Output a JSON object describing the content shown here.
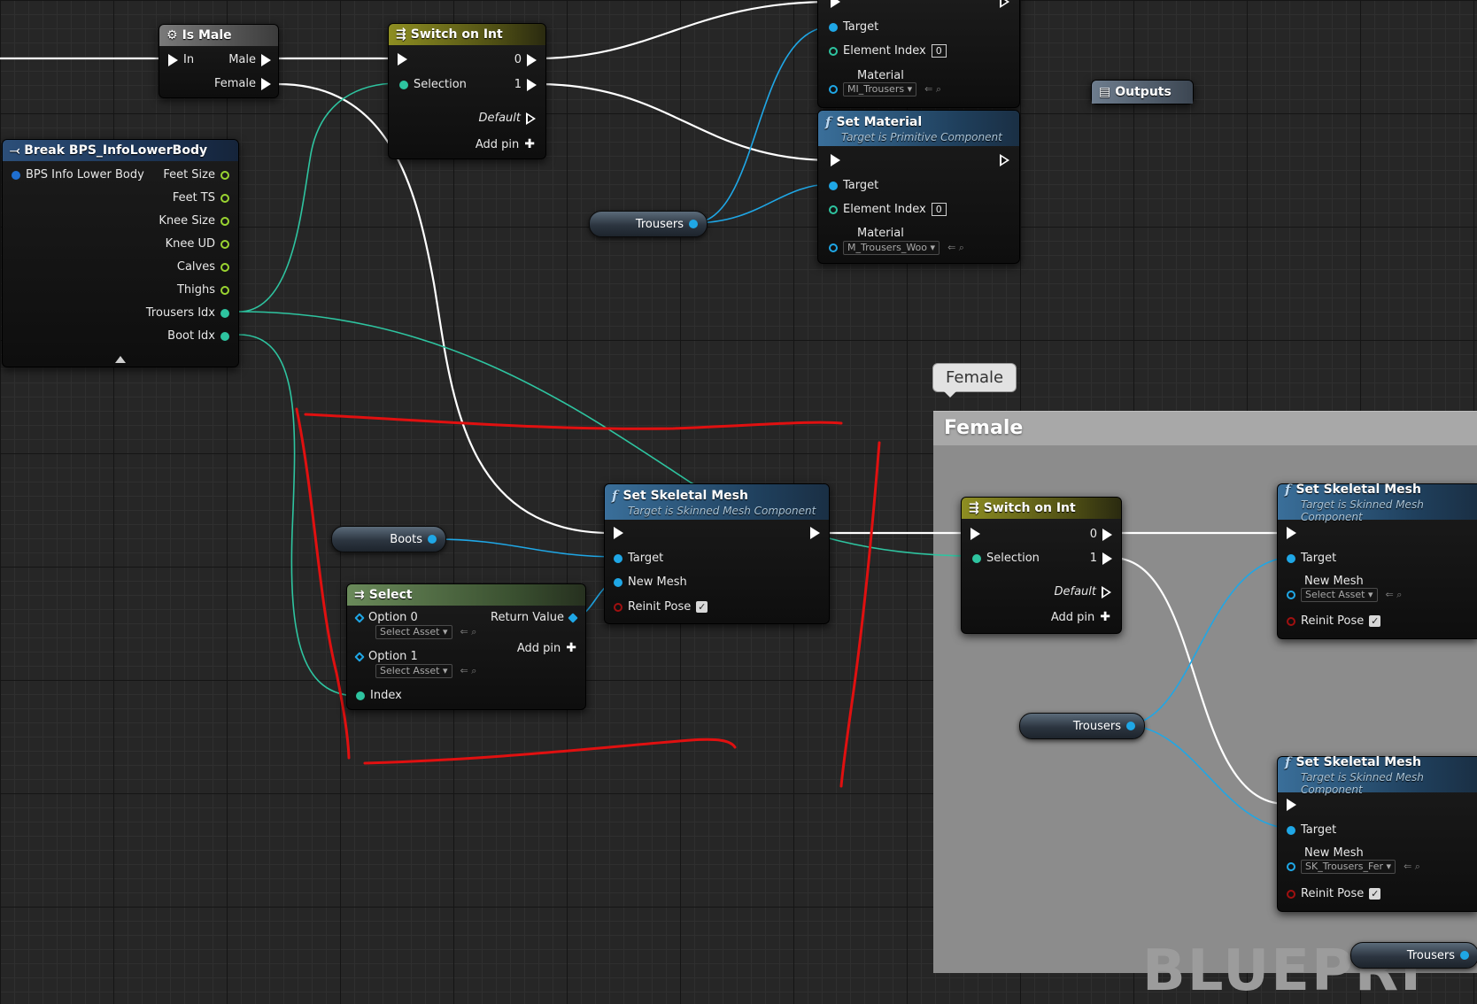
{
  "colors": {
    "exec_wire": "#ffffff",
    "int_wire": "#2ec4a0",
    "object_wire": "#1fa7e6",
    "annotation": "#e01010",
    "comment_fill": "#8c8c8c"
  },
  "nodes": {
    "is_male": {
      "title": "Is Male",
      "in": "In",
      "male": "Male",
      "female": "Female"
    },
    "switch_top": {
      "title": "Switch on Int",
      "selection": "Selection",
      "out0": "0",
      "out1": "1",
      "default": "Default",
      "add_pin": "Add pin"
    },
    "set_material_top": {
      "target": "Target",
      "element_index": "Element Index",
      "element_index_value": "0",
      "material": "Material",
      "material_value": "MI_Trousers"
    },
    "outputs": {
      "title": "Outputs"
    },
    "set_material": {
      "title": "Set Material",
      "subtitle": "Target is Primitive Component",
      "target": "Target",
      "element_index": "Element Index",
      "element_index_value": "0",
      "material": "Material",
      "material_value": "M_Trousers_Woo"
    },
    "break_info": {
      "title": "Break BPS_InfoLowerBody",
      "input": "BPS Info Lower Body",
      "outputs": [
        "Feet Size",
        "Feet TS",
        "Knee Size",
        "Knee UD",
        "Calves",
        "Thighs",
        "Trousers Idx",
        "Boot Idx"
      ]
    },
    "var_trousers_top": {
      "label": "Trousers"
    },
    "var_boots": {
      "label": "Boots"
    },
    "set_skeletal_mid": {
      "title": "Set Skeletal Mesh",
      "subtitle": "Target is Skinned Mesh Component",
      "target": "Target",
      "new_mesh": "New Mesh",
      "reinit": "Reinit Pose"
    },
    "select": {
      "title": "Select",
      "option0": "Option 0",
      "option1": "Option 1",
      "option_value": "Select Asset",
      "return_value": "Return Value",
      "add_pin": "Add pin",
      "index": "Index"
    },
    "switch_female": {
      "title": "Switch on Int",
      "selection": "Selection",
      "out0": "0",
      "out1": "1",
      "default": "Default",
      "add_pin": "Add pin"
    },
    "var_trousers_female": {
      "label": "Trousers"
    },
    "set_skeletal_right_top": {
      "title": "Set Skeletal Mesh",
      "subtitle": "Target is Skinned Mesh Component",
      "target": "Target",
      "new_mesh": "New Mesh",
      "new_mesh_value": "Select Asset",
      "reinit": "Reinit Pose"
    },
    "set_skeletal_right_bottom": {
      "title": "Set Skeletal Mesh",
      "subtitle": "Target is Skinned Mesh Component",
      "target": "Target",
      "new_mesh": "New Mesh",
      "new_mesh_value": "SK_Trousers_Fer",
      "reinit": "Reinit Pose"
    },
    "var_trousers_bottom": {
      "label": "Trousers"
    }
  },
  "comment": {
    "bubble": "Female",
    "header": "Female",
    "watermark": "BLUEPRI"
  },
  "icons": {
    "function": "function-f-icon",
    "switch": "switch-icon",
    "gear": "gear-icon",
    "break": "break-struct-icon",
    "select": "select-icon",
    "outputs": "outputs-icon"
  }
}
